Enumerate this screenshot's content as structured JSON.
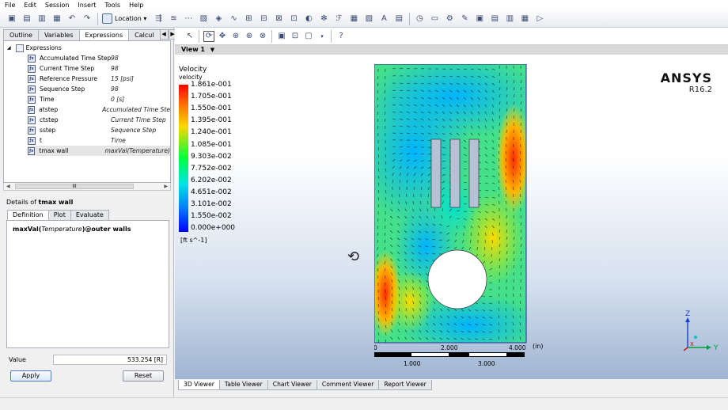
{
  "menu": [
    "File",
    "Edit",
    "Session",
    "Insert",
    "Tools",
    "Help"
  ],
  "toolbar": {
    "location_label": "Location",
    "icons": [
      "new-icon",
      "load-icon",
      "save-icon",
      "print-icon",
      "undo-icon",
      "redo-icon"
    ]
  },
  "left_tabs": [
    "Outline",
    "Variables",
    "Expressions",
    "Calcul"
  ],
  "tree": {
    "root": "Expressions",
    "items": [
      {
        "name": "Accumulated Time Step",
        "value": "98"
      },
      {
        "name": "Current Time Step",
        "value": "98"
      },
      {
        "name": "Reference Pressure",
        "value": "15 [psi]"
      },
      {
        "name": "Sequence Step",
        "value": "98"
      },
      {
        "name": "Time",
        "value": "0 [s]"
      },
      {
        "name": "atstep",
        "value": "Accumulated Time Ste"
      },
      {
        "name": "ctstep",
        "value": "Current Time Step"
      },
      {
        "name": "sstep",
        "value": "Sequence Step"
      },
      {
        "name": "t",
        "value": "Time"
      },
      {
        "name": "tmax wall",
        "value": "maxVal(Temperature)"
      }
    ],
    "scroll_glyph": "III"
  },
  "details": {
    "prefix": "Details of ",
    "name": "tmax wall",
    "tabs": [
      "Definition",
      "Plot",
      "Evaluate"
    ],
    "definition_fn": "maxVal(",
    "definition_arg": "Temperature",
    "definition_rest": ")@outer walls",
    "value_label": "Value",
    "value": "533.254 [R]",
    "apply_label": "Apply",
    "reset_label": "Reset"
  },
  "viewer": {
    "view_label": "View 1",
    "view_dropdown": "▼",
    "bottom_tabs": [
      "3D Viewer",
      "Table Viewer",
      "Chart Viewer",
      "Comment Viewer",
      "Report Viewer"
    ]
  },
  "legend": {
    "title": "Velocity",
    "variable": "velocity",
    "ticks": [
      "1.861e-001",
      "1.705e-001",
      "1.550e-001",
      "1.395e-001",
      "1.240e-001",
      "1.085e-001",
      "9.303e-002",
      "7.752e-002",
      "6.202e-002",
      "4.651e-002",
      "3.101e-002",
      "1.550e-002",
      "0.000e+000"
    ],
    "unit": "[ft s^-1]",
    "colors": [
      "#ff0000",
      "#ff6d00",
      "#ffd600",
      "#00ff3c",
      "#00e6e6",
      "#0073ff",
      "#0000ff"
    ]
  },
  "brand": {
    "name": "ANSYS",
    "version": "R16.2"
  },
  "ruler": {
    "top_labels": [
      "0",
      "2.000",
      "4.000"
    ],
    "bottom_labels": [
      "1.000",
      "3.000"
    ],
    "unit": "(in)"
  },
  "axes": {
    "z": "Z",
    "x": "X",
    "y": "Y"
  }
}
